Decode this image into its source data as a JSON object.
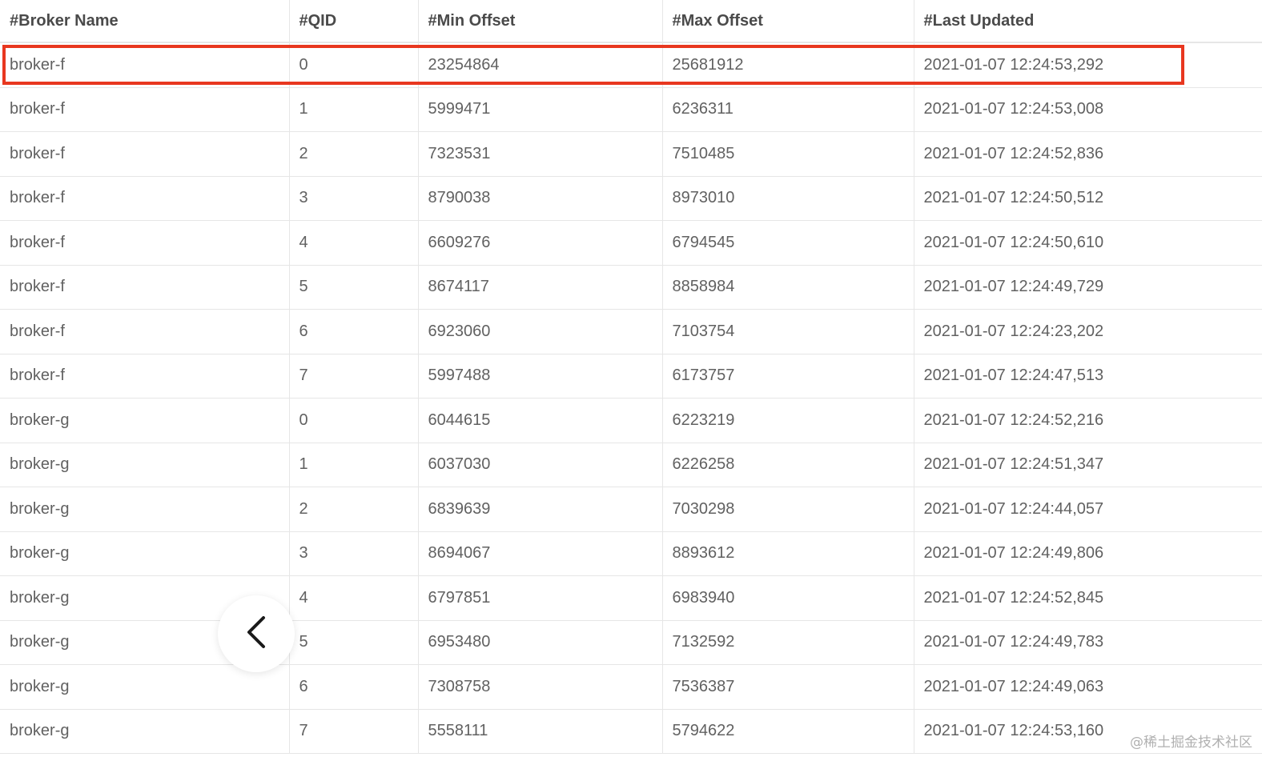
{
  "table": {
    "headers": [
      "#Broker Name",
      "#QID",
      "#Min Offset",
      "#Max Offset",
      "#Last Updated"
    ],
    "rows": [
      [
        "broker-f",
        "0",
        "23254864",
        "25681912",
        "2021-01-07 12:24:53,292"
      ],
      [
        "broker-f",
        "1",
        "5999471",
        "6236311",
        "2021-01-07 12:24:53,008"
      ],
      [
        "broker-f",
        "2",
        "7323531",
        "7510485",
        "2021-01-07 12:24:52,836"
      ],
      [
        "broker-f",
        "3",
        "8790038",
        "8973010",
        "2021-01-07 12:24:50,512"
      ],
      [
        "broker-f",
        "4",
        "6609276",
        "6794545",
        "2021-01-07 12:24:50,610"
      ],
      [
        "broker-f",
        "5",
        "8674117",
        "8858984",
        "2021-01-07 12:24:49,729"
      ],
      [
        "broker-f",
        "6",
        "6923060",
        "7103754",
        "2021-01-07 12:24:23,202"
      ],
      [
        "broker-f",
        "7",
        "5997488",
        "6173757",
        "2021-01-07 12:24:47,513"
      ],
      [
        "broker-g",
        "0",
        "6044615",
        "6223219",
        "2021-01-07 12:24:52,216"
      ],
      [
        "broker-g",
        "1",
        "6037030",
        "6226258",
        "2021-01-07 12:24:51,347"
      ],
      [
        "broker-g",
        "2",
        "6839639",
        "7030298",
        "2021-01-07 12:24:44,057"
      ],
      [
        "broker-g",
        "3",
        "8694067",
        "8893612",
        "2021-01-07 12:24:49,806"
      ],
      [
        "broker-g",
        "4",
        "6797851",
        "6983940",
        "2021-01-07 12:24:52,845"
      ],
      [
        "broker-g",
        "5",
        "6953480",
        "7132592",
        "2021-01-07 12:24:49,783"
      ],
      [
        "broker-g",
        "6",
        "7308758",
        "7536387",
        "2021-01-07 12:24:49,063"
      ],
      [
        "broker-g",
        "7",
        "5558111",
        "5794622",
        "2021-01-07 12:24:53,160"
      ]
    ]
  },
  "highlight": {
    "row_index": 0,
    "color": "#e8371f"
  },
  "back_button": {
    "icon": "chevron-left-icon"
  },
  "watermark": {
    "text": "@稀土掘金技术社区"
  }
}
